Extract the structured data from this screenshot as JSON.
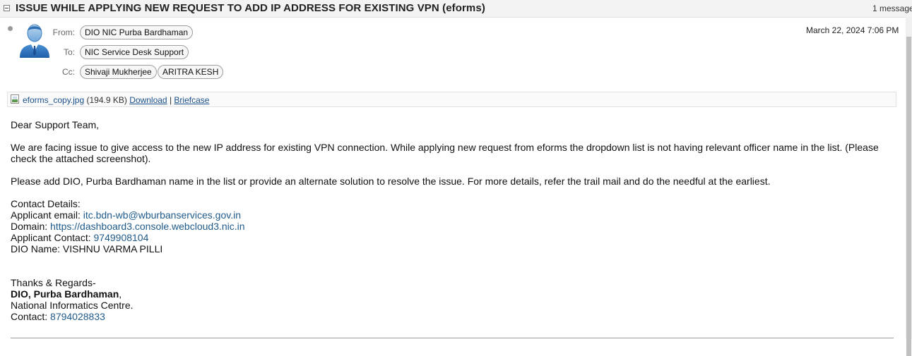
{
  "header": {
    "subject": "ISSUE WHILE APPLYING NEW REQUEST TO ADD IP ADDRESS FOR EXISTING VPN (eforms)",
    "message_count": "1 message"
  },
  "message": {
    "from_label": "From:",
    "from": "DIO NIC Purba Bardhaman",
    "to_label": "To:",
    "to": "NIC Service Desk Support",
    "cc_label": "Cc:",
    "cc": [
      "Shivaji Mukherjee",
      "ARITRA KESH"
    ],
    "date": "March 22, 2024 7:06 PM"
  },
  "attachment": {
    "name": "eforms_copy.jpg",
    "size": "(194.9 KB)",
    "download": "Download",
    "separator": "|",
    "briefcase": "Briefcase"
  },
  "body": {
    "greeting": "Dear Support Team,",
    "para1": "We are facing issue to give access to the new IP address for existing VPN connection. While applying new request from eforms the dropdown list is not having relevant officer name in the list. (Please check the attached screenshot).",
    "para2": "Please add DIO, Purba Bardhaman name in the list or provide an alternate solution to resolve the issue. For more details, refer the trail mail and do the needful at the earliest.",
    "contact_heading": "Contact Details:",
    "email_label": "Applicant email:",
    "email": "itc.bdn-wb@wburbanservices.gov.in",
    "domain_label": "Domain:",
    "domain": "https://dashboard3.console.webcloud3.nic.in",
    "contact_label": "Applicant Contact:",
    "contact": "9749908104",
    "dio_label": "DIO Name:",
    "dio": "VISHNU VARMA PILLI",
    "thanks": "Thanks & Regards-",
    "sign_name": "DIO, Purba Bardhaman",
    "sign_comma": ",",
    "org": "National Informatics Centre.",
    "sign_contact_label": "Contact:",
    "sign_contact": "8794028833"
  },
  "icons": {
    "collapse": "collapse-icon",
    "avatar": "avatar-icon",
    "attachment": "image-file-icon"
  }
}
